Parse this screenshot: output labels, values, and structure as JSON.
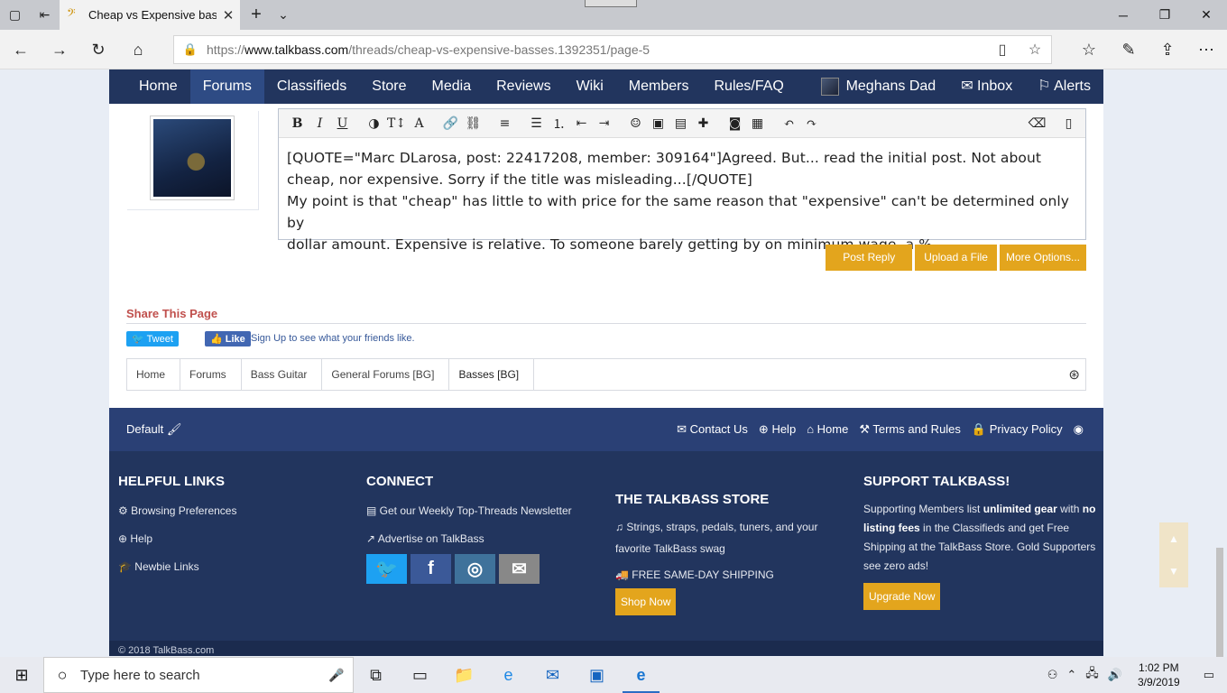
{
  "browser": {
    "tab_title": "Cheap vs Expensive bas",
    "url_prefix": "https://",
    "url_domain": "www.talkbass.com",
    "url_path": "/threads/cheap-vs-expensive-basses.1392351/page-5"
  },
  "nav": {
    "items": [
      "Home",
      "Forums",
      "Classifieds",
      "Store",
      "Media",
      "Reviews",
      "Wiki",
      "Members",
      "Rules/FAQ"
    ],
    "active": "Forums",
    "user": "Meghans Dad",
    "inbox": "Inbox",
    "alerts": "Alerts"
  },
  "editor": {
    "toolbar_icons": [
      "bold-icon",
      "italic-icon",
      "underline-icon",
      "color-icon",
      "text-size-icon",
      "font-icon",
      "link-icon",
      "unlink-icon",
      "align-icon",
      "bullet-list-icon",
      "numbered-list-icon",
      "outdent-icon",
      "indent-icon",
      "smilie-icon",
      "image-icon",
      "media-icon",
      "insert-icon",
      "camera-icon",
      "save-draft-icon",
      "undo-icon",
      "redo-icon",
      "eraser-icon",
      "bbcode-icon"
    ],
    "line1": "[QUOTE=\"Marc DLarosa, post: 22417208, member: 309164\"]Agreed. But... read the initial post. Not about",
    "line2": "cheap, nor expensive. Sorry if the title was misleading...[/QUOTE]",
    "line3": "My point is that \"cheap\" has little to with price for the same reason that \"expensive\" can't be determined only by",
    "line4": "dollar amount. Expensive is relative.  To someone barely getting by on minimum wage, a %"
  },
  "buttons": {
    "post_reply": "Post Reply",
    "upload": "Upload a File",
    "more": "More Options..."
  },
  "share": {
    "title": "Share This Page",
    "tweet": "Tweet",
    "like": "Like",
    "signup": "Sign Up",
    "signup_rest": " to see what your friends like."
  },
  "breadcrumb": [
    "Home",
    "Forums",
    "Bass Guitar",
    "General Forums [BG]",
    "Basses [BG]"
  ],
  "footer_bar": {
    "default": "Default",
    "links": [
      "Contact Us",
      "Help",
      "Home",
      "Terms and Rules",
      "Privacy Policy"
    ]
  },
  "footer": {
    "helpful_title": "HELPFUL LINKS",
    "helpful": [
      "Browsing Preferences",
      "Help",
      "Newbie Links"
    ],
    "connect_title": "CONNECT",
    "connect": [
      "Get our Weekly Top-Threads Newsletter",
      "Advertise on TalkBass"
    ],
    "store_title": "THE TALKBASS STORE",
    "store_line1": "Strings, straps, pedals, tuners, and your",
    "store_line2": "favorite TalkBass swag",
    "store_shipping": "FREE SAME-DAY SHIPPING",
    "shop_now": "Shop Now",
    "support_title": "SUPPORT TALKBASS!",
    "support_a": "Supporting Members list ",
    "support_b": "unlimited gear",
    "support_c": " with ",
    "support_d": "no listing fees",
    "support_e": " in the Classifieds and get Free Shipping at the TalkBass Store. Gold Supporters see zero ads!",
    "upgrade": "Upgrade Now",
    "copyright": "© 2018 TalkBass.com"
  },
  "taskbar": {
    "search_placeholder": "Type here to search",
    "time": "1:02 PM",
    "date": "3/9/2019"
  },
  "colors": {
    "nav_bg": "#22355e",
    "accent": "#e3a51d",
    "footer_bar": "#2a4075"
  }
}
